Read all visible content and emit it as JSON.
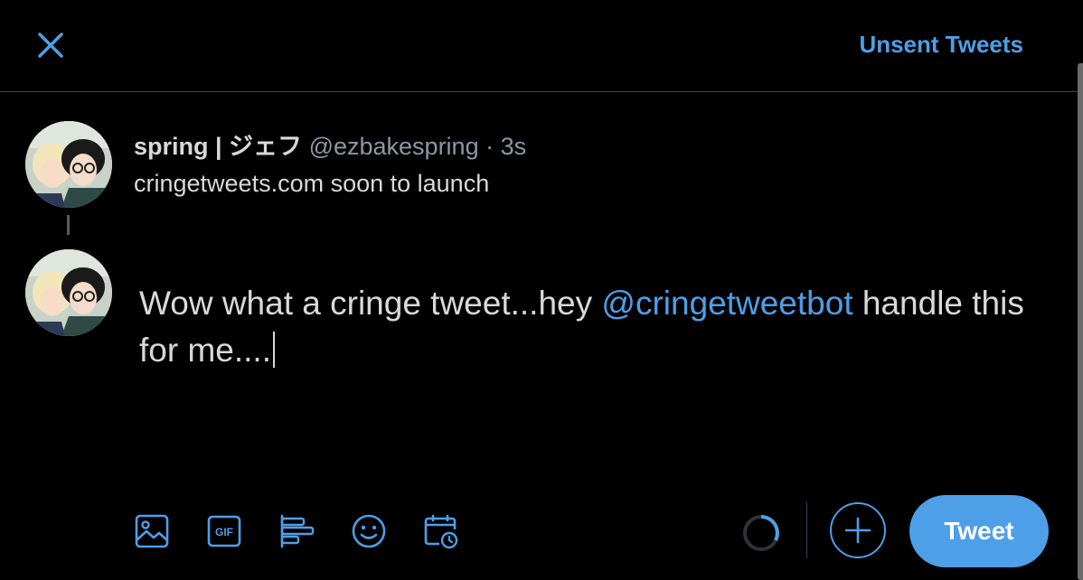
{
  "header": {
    "close_icon": "close-icon",
    "unsent_label": "Unsent Tweets"
  },
  "parent_tweet": {
    "display_name": "spring | ジェフ",
    "handle": "@ezbakespring",
    "separator": " · ",
    "time": "3s",
    "text": "cringetweets.com soon to launch"
  },
  "composer": {
    "text_before": "Wow what a cringe tweet...hey ",
    "mention": "@cringetweetbot",
    "text_after": " handle this for me...."
  },
  "toolbar": {
    "icons": [
      "image-icon",
      "gif-icon",
      "poll-icon",
      "emoji-icon",
      "schedule-icon"
    ],
    "add_icon": "plus-icon",
    "tweet_label": "Tweet"
  },
  "colors": {
    "accent": "#4d9fe8",
    "background": "#000000",
    "border": "#38444d",
    "muted_text": "#8b98a5"
  }
}
